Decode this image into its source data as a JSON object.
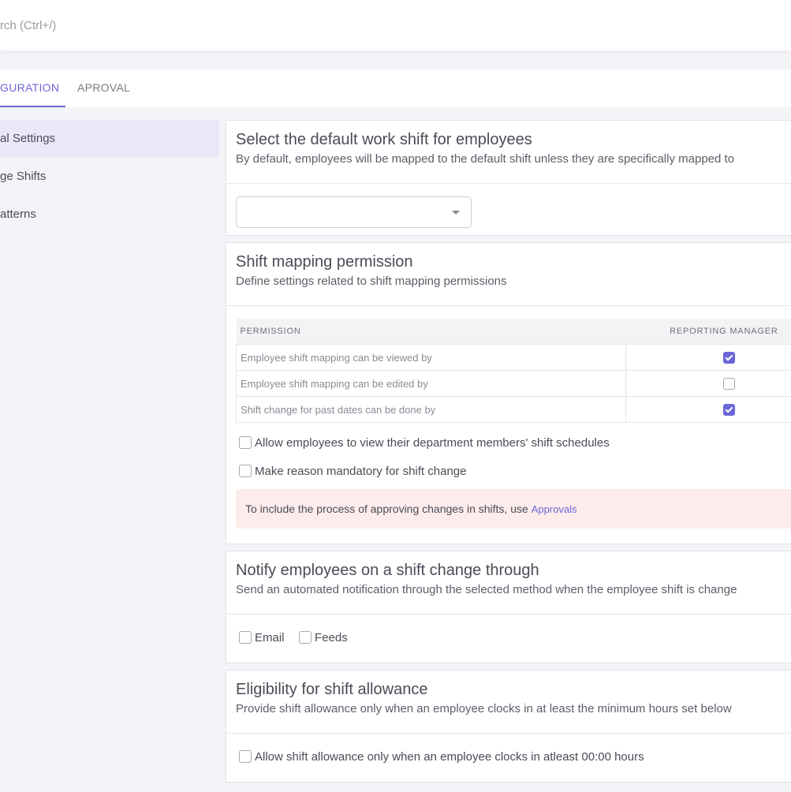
{
  "header": {
    "search_placeholder": "rch (Ctrl+/)"
  },
  "tabs": [
    {
      "label": "GURATION",
      "active": true
    },
    {
      "label": "APROVAL",
      "active": false
    }
  ],
  "sidebar": {
    "items": [
      {
        "label": "al Settings",
        "active": true
      },
      {
        "label": "ge Shifts",
        "active": false
      },
      {
        "label": "atterns",
        "active": false
      }
    ]
  },
  "default_shift": {
    "title": "Select the default work shift for employees",
    "subtitle": "By default, employees will be mapped to the default shift unless they are specifically mapped to",
    "select_value": ""
  },
  "mapping_permission": {
    "title": "Shift mapping permission",
    "subtitle": "Define settings related to shift mapping permissions",
    "columns": [
      "PERMISSION",
      "REPORTING MANAGER"
    ],
    "rows": [
      {
        "label": "Employee shift mapping can be viewed by",
        "reporting_manager": true
      },
      {
        "label": "Employee shift mapping can be edited by",
        "reporting_manager": false
      },
      {
        "label": "Shift change for past dates can be done by",
        "reporting_manager": true
      }
    ],
    "options": [
      {
        "label": "Allow employees to view their department members' shift schedules",
        "checked": false
      },
      {
        "label": "Make reason mandatory for shift change",
        "checked": false
      }
    ],
    "info_text": "To include the process of approving changes in shifts, use",
    "info_link": "Approvals"
  },
  "notify": {
    "title": "Notify employees on a shift change through",
    "subtitle": "Send an automated notification through the selected method when the employee shift is change",
    "options": [
      {
        "label": "Email",
        "checked": false
      },
      {
        "label": "Feeds",
        "checked": false
      }
    ]
  },
  "allowance": {
    "title": "Eligibility for shift allowance",
    "subtitle": "Provide shift allowance only when an employee clocks in at least the minimum hours set below",
    "option_label": "Allow shift allowance only when an employee clocks in atleast 00:00 hours",
    "checked": false
  },
  "colors": {
    "accent": "#6b66d8",
    "info_bg": "#fdeceb",
    "active_bg": "#e9e8f8"
  }
}
